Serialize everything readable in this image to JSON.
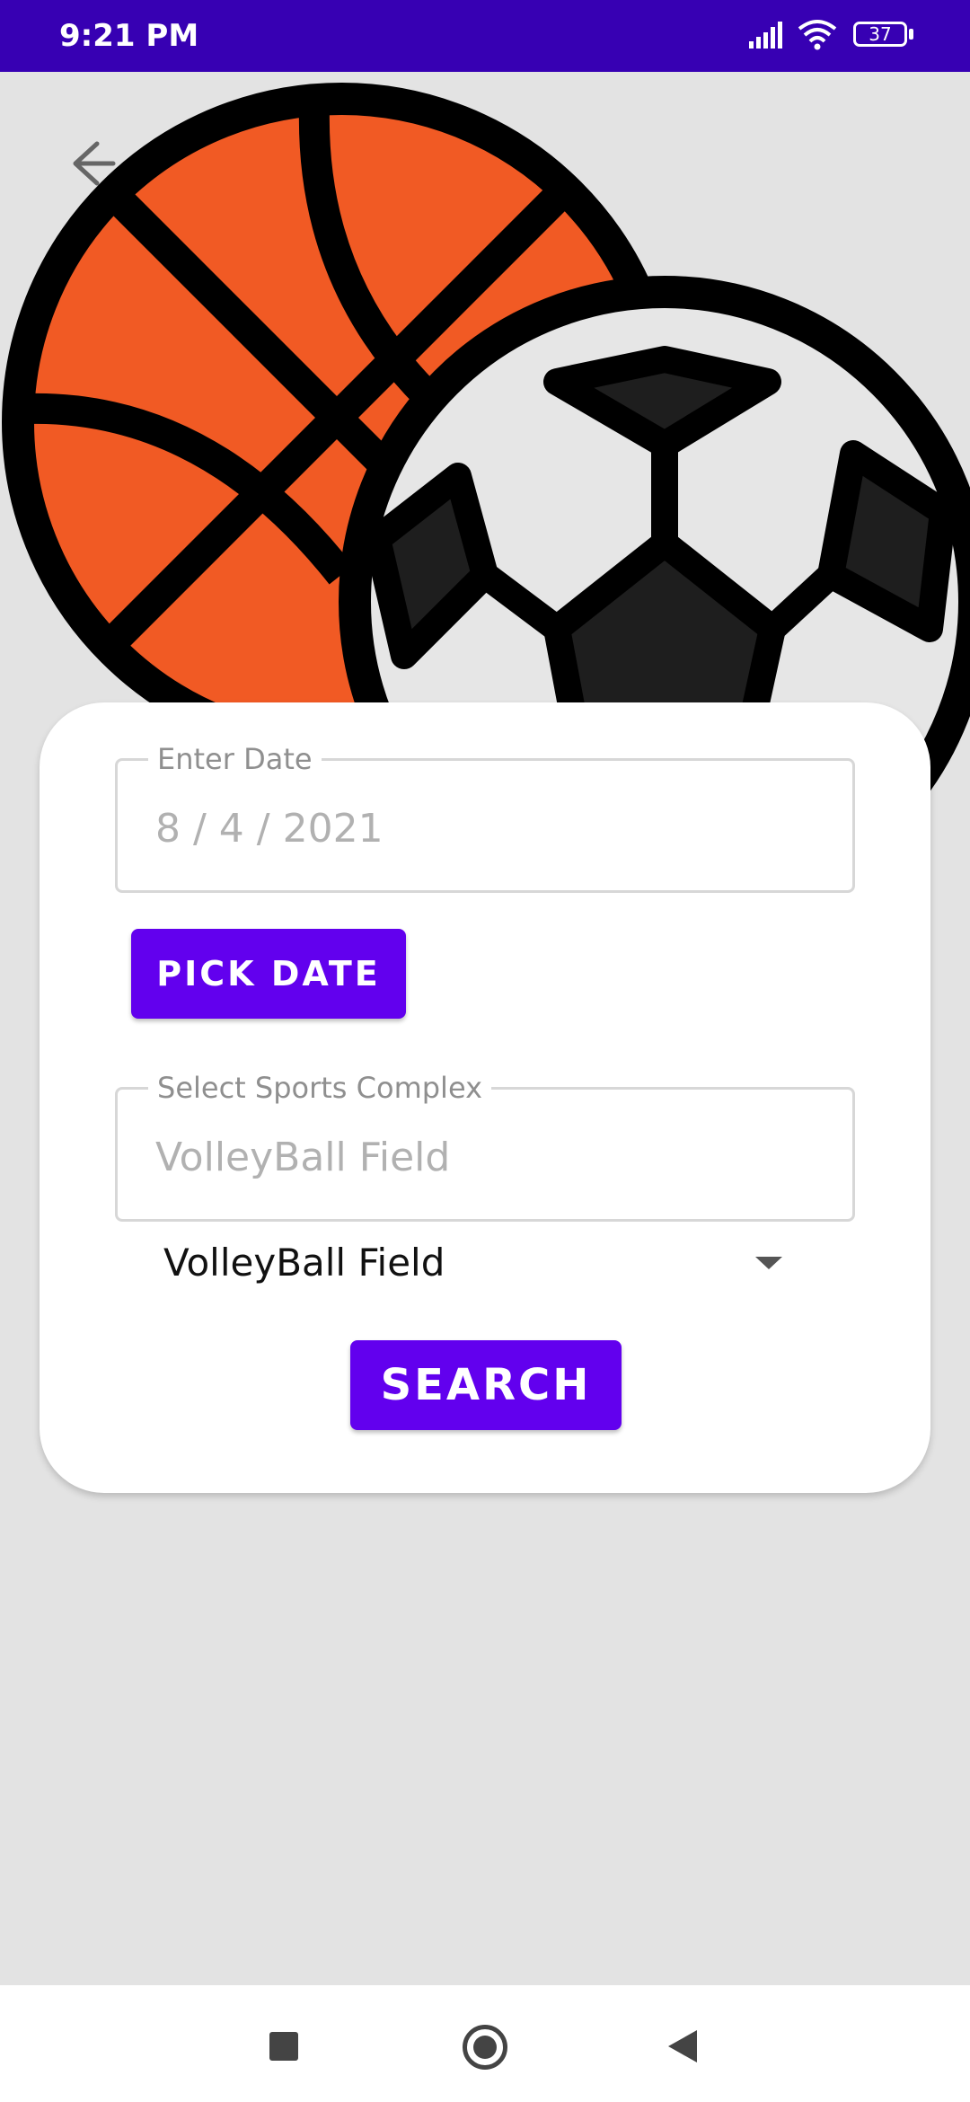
{
  "status_bar": {
    "time": "9:21 PM",
    "battery": "37"
  },
  "form": {
    "date_label": "Enter Date",
    "date_value": "8 / 4 / 2021",
    "pick_date_button": "PICK DATE",
    "complex_label": "Select Sports Complex",
    "complex_value": "VolleyBall Field",
    "spinner_selected": "VolleyBall Field",
    "search_button": "SEARCH"
  },
  "colors": {
    "status_bar": "#3700b3",
    "accent": "#6200ee",
    "background": "#e3e3e3",
    "basketball": "#f15a24"
  }
}
